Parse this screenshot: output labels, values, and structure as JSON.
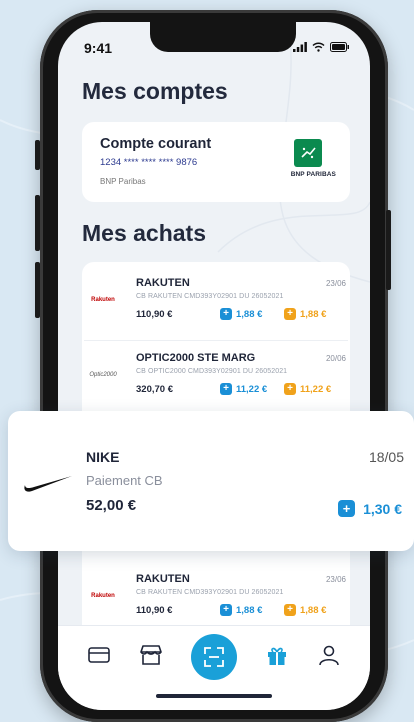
{
  "status": {
    "time": "9:41"
  },
  "accounts": {
    "title": "Mes comptes",
    "account": {
      "name": "Compte courant",
      "number": "1234 **** **** **** 9876",
      "bank": "BNP Paribas",
      "logo_text": "BNP PARIBAS"
    }
  },
  "purchases": {
    "title": "Mes achats",
    "items": [
      {
        "merchant": "RAKUTEN",
        "logo": "Rakuten",
        "date": "23/06",
        "description": "CB RAKUTEN CMD393Y02901 DU 26052021",
        "amount": "110,90 €",
        "cashback_blue": "1,88 €",
        "cashback_orange": "1,88 €"
      },
      {
        "merchant": "OPTIC2000 STE MARG",
        "logo": "Optic2000",
        "date": "20/06",
        "description": "CB OPTIC2000 CMD393Y02901 DU 26052021",
        "amount": "320,70 €",
        "cashback_blue": "11,22 €",
        "cashback_orange": "11,22 €"
      },
      {
        "merchant": "RAKUTEN",
        "logo": "Rakuten",
        "date": "23/06",
        "description": "CB RAKUTEN CMD393Y02901 DU 26052021",
        "amount": "110,90 €",
        "cashback_blue": "1,88 €",
        "cashback_orange": "1,88 €"
      }
    ],
    "highlight": {
      "merchant": "NIKE",
      "logo": "nike-swoosh-icon",
      "date": "18/05",
      "description": "Paiement CB",
      "amount": "52,00 €",
      "cashback": "1,30 €"
    }
  },
  "colors": {
    "accent": "#1aa0d8",
    "cashback_blue": "#1a8fd6",
    "cashback_orange": "#f0a21b",
    "bnp_green": "#0b8a4f"
  },
  "navbar": {
    "items": [
      "card-icon",
      "store-icon",
      "scan-icon",
      "gift-icon",
      "profile-icon"
    ]
  }
}
